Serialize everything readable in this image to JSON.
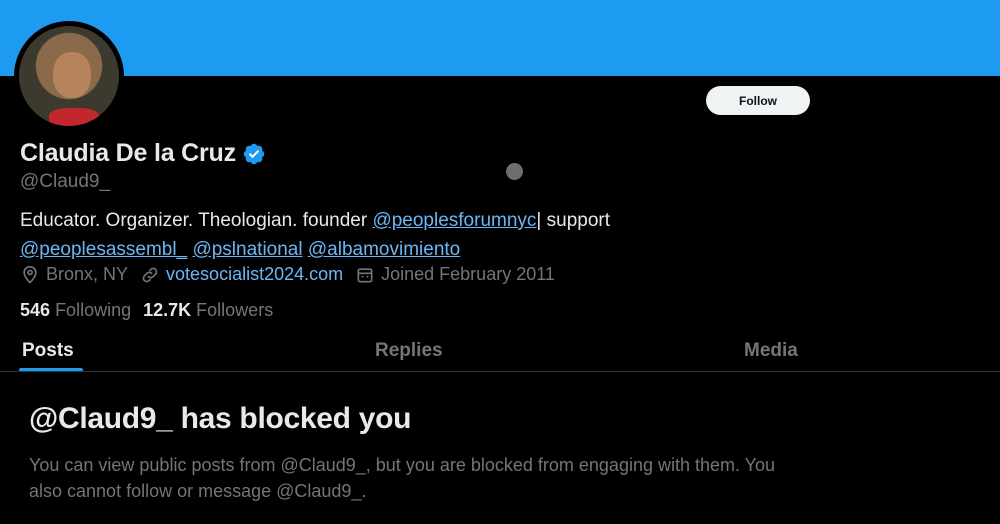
{
  "colors": {
    "banner": "#1d9bf0",
    "link": "#6cb6f5",
    "verified": "#1d9bf0",
    "muted": "#71767b"
  },
  "profile": {
    "name": "Claudia De la Cruz",
    "handle": "@Claud9_",
    "follow_label": "Follow",
    "bio": {
      "text1": "Educator. Organizer. Theologian. founder ",
      "mention1": "@peoplesforumnyc",
      "text2": "| support",
      "mention2": "@peoplesassembl_",
      "mention3": "@pslnational",
      "mention4": "@albamovimiento"
    },
    "location": "Bronx, NY",
    "website": "votesocialist2024.com",
    "joined": "Joined February 2011",
    "following_count": "546",
    "following_label": "Following",
    "followers_count": "12.7K",
    "followers_label": "Followers"
  },
  "tabs": [
    {
      "label": "Posts",
      "active": true
    },
    {
      "label": "Replies",
      "active": false
    },
    {
      "label": "Media",
      "active": false
    }
  ],
  "blocked": {
    "title": "@Claud9_ has blocked you",
    "message": "You can view public posts from @Claud9_, but you are blocked from engaging with them. You also cannot follow or message @Claud9_."
  },
  "icons": [
    "verified-badge-icon",
    "location-pin-icon",
    "link-icon",
    "calendar-icon"
  ]
}
